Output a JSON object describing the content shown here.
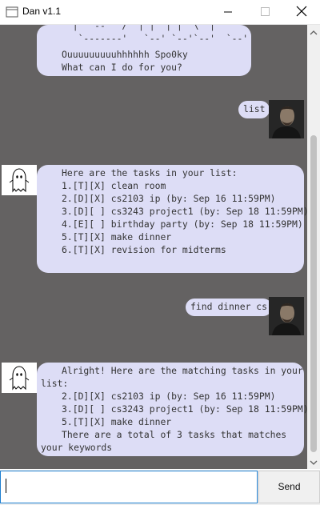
{
  "window": {
    "title": "Dan v1.1"
  },
  "chat": {
    "greeting_art_line1": "  |  '--'  /  | |  | |  \\  |",
    "greeting_art_line2": "   `-------'   `--' `--'`--'  `--'",
    "greeting_line1": "Ouuuuuuuuuhhhhhh Spo0ky",
    "greeting_line2": "What can I do for you?",
    "user_msg_1": "list",
    "reply_1": [
      "Here are the tasks in your list:",
      "1.[T][X] clean room",
      "2.[D][X] cs2103 ip (by: Sep 16 11:59PM)",
      "3.[D][ ] cs3243 project1 (by: Sep 18 11:59PM)",
      "4.[E][ ] birthday party (by: Sep 18 11:59PM)",
      "5.[T][X] make dinner",
      "6.[T][X] revision for midterms"
    ],
    "user_msg_2": "find dinner cs",
    "reply_2": [
      "Alright! Here are the matching tasks in your",
      "list:",
      "2.[D][X] cs2103 ip (by: Sep 16 11:59PM)",
      "3.[D][ ] cs3243 project1 (by: Sep 18 11:59PM)",
      "5.[T][X] make dinner",
      "There are a total of 3 tasks that matches",
      "your keywords"
    ]
  },
  "input": {
    "value": "",
    "send_label": "Send"
  },
  "colors": {
    "chat_bg": "#646262",
    "bubble": "#ddddf6",
    "input_focus": "#1e7fd0"
  }
}
